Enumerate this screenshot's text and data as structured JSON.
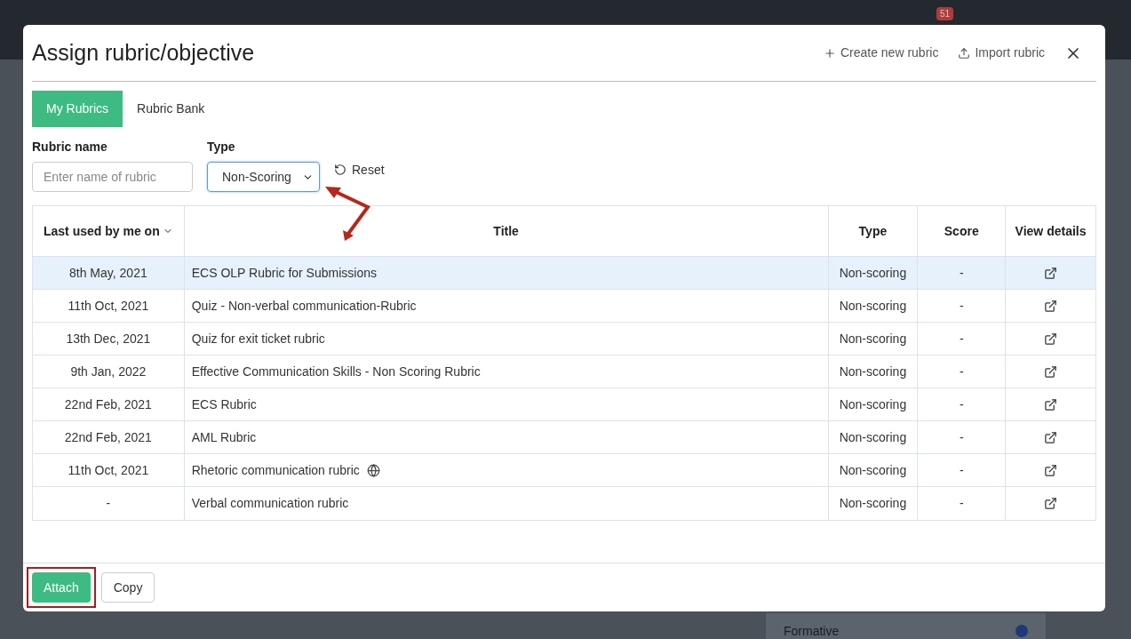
{
  "background": {
    "notification_count": "51",
    "option": {
      "label": "Formative",
      "selected": true
    }
  },
  "dialog": {
    "title": "Assign rubric/objective",
    "actions": [
      {
        "kind": "plus",
        "label": "Create new rubric"
      },
      {
        "kind": "upload",
        "label": "Import rubric"
      }
    ],
    "tabs": [
      {
        "label": "My Rubrics",
        "selected": true
      },
      {
        "label": "Rubric Bank",
        "selected": false
      }
    ],
    "filters": {
      "name_label": "Rubric name",
      "name_placeholder": "Enter name of rubric",
      "type_label": "Type",
      "type_value": "Non-Scoring",
      "reset": "Reset"
    },
    "table": {
      "columns": [
        "Last used by me on",
        "Title",
        "Type",
        "Score",
        "View details"
      ],
      "rows": [
        {
          "last_used": "8th May, 2021",
          "title": "ECS OLP Rubric for Submissions",
          "shared": false,
          "type": "Non-scoring",
          "score": "-",
          "selected": true
        },
        {
          "last_used": "11th Oct, 2021",
          "title": "Quiz - Non-verbal communication-Rubric",
          "shared": false,
          "type": "Non-scoring",
          "score": "-",
          "selected": false
        },
        {
          "last_used": "13th Dec, 2021",
          "title": "Quiz for exit ticket rubric",
          "shared": false,
          "type": "Non-scoring",
          "score": "-",
          "selected": false
        },
        {
          "last_used": "9th Jan, 2022",
          "title": "Effective Communication Skills - Non Scoring Rubric",
          "shared": false,
          "type": "Non-scoring",
          "score": "-",
          "selected": false
        },
        {
          "last_used": "22nd Feb, 2021",
          "title": "ECS Rubric",
          "shared": false,
          "type": "Non-scoring",
          "score": "-",
          "selected": false
        },
        {
          "last_used": "22nd Feb, 2021",
          "title": "AML Rubric",
          "shared": false,
          "type": "Non-scoring",
          "score": "-",
          "selected": false
        },
        {
          "last_used": "11th Oct, 2021",
          "title": "Rhetoric communication rubric",
          "shared": true,
          "type": "Non-scoring",
          "score": "-",
          "selected": false
        },
        {
          "last_used": "-",
          "title": "Verbal communication rubric",
          "shared": false,
          "type": "Non-scoring",
          "score": "-",
          "selected": false
        }
      ]
    },
    "footer": [
      {
        "label": "Attach",
        "kind": "primary",
        "highlighted": true
      },
      {
        "label": "Copy",
        "kind": "secondary",
        "highlighted": false
      }
    ]
  }
}
